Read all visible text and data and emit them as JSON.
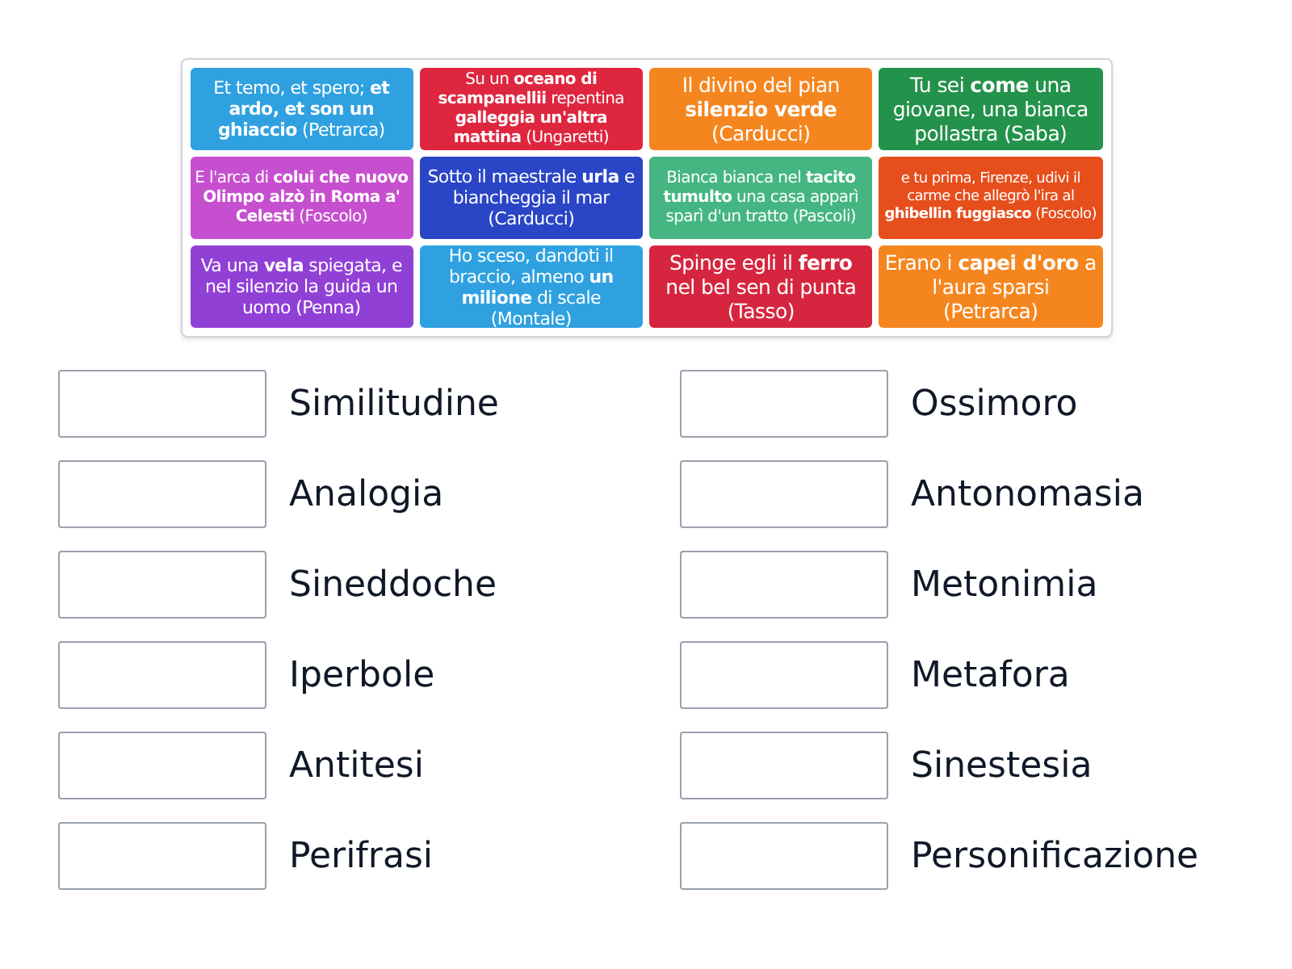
{
  "cards": [
    {
      "text": "Et temo, et spero; **et ardo, et son un ghiaccio** (Petrarca)",
      "color": "#2fa1e0"
    },
    {
      "text": "Su un **oceano di scampanellii** repentina **galleggia un'altra mattina** (Ungaretti)",
      "color": "#df263f"
    },
    {
      "text": "Il divino del pian **silenzio verde** (Carducci)",
      "color": "#f5861f"
    },
    {
      "text": "Tu sei **come** una giovane, una bianca pollastra (Saba)",
      "color": "#23924a"
    },
    {
      "text": "E l'arca di **colui che nuovo Olimpo alzò in Roma a' Celesti** (Foscolo)",
      "color": "#c64fcf"
    },
    {
      "text": "Sotto il maestrale **urla** e biancheggia il mar (Carducci)",
      "color": "#2a45c6"
    },
    {
      "text": "Bianca bianca nel **tacito tumulto** una casa apparì sparì d'un tratto (Pascoli)",
      "color": "#45b681"
    },
    {
      "text": "e tu prima, Firenze, udivi il carme che allegrò l'ira al **ghibellin fuggiasco** (Foscolo)",
      "color": "#e64e1c"
    },
    {
      "text": "Va una **vela** spiegata, e nel silenzio la guida un uomo (Penna)",
      "color": "#9140d6"
    },
    {
      "text": "Ho sceso, dandoti il braccio, almeno **un milione** di scale (Montale)",
      "color": "#2fa1e0"
    },
    {
      "text": "Spinge egli il **ferro** nel bel sen di punta (Tasso)",
      "color": "#d6263f"
    },
    {
      "text": "Erano i **capei d'oro** a l'aura sparsi (Petrarca)",
      "color": "#f5861f"
    }
  ],
  "answers": [
    {
      "label": "Similitudine"
    },
    {
      "label": "Ossimoro"
    },
    {
      "label": "Analogia"
    },
    {
      "label": "Antonomasia"
    },
    {
      "label": "Sineddoche"
    },
    {
      "label": "Metonimia"
    },
    {
      "label": "Iperbole"
    },
    {
      "label": "Metafora"
    },
    {
      "label": "Antitesi"
    },
    {
      "label": "Sinestesia"
    },
    {
      "label": "Perifrasi"
    },
    {
      "label": "Personificazione"
    }
  ]
}
